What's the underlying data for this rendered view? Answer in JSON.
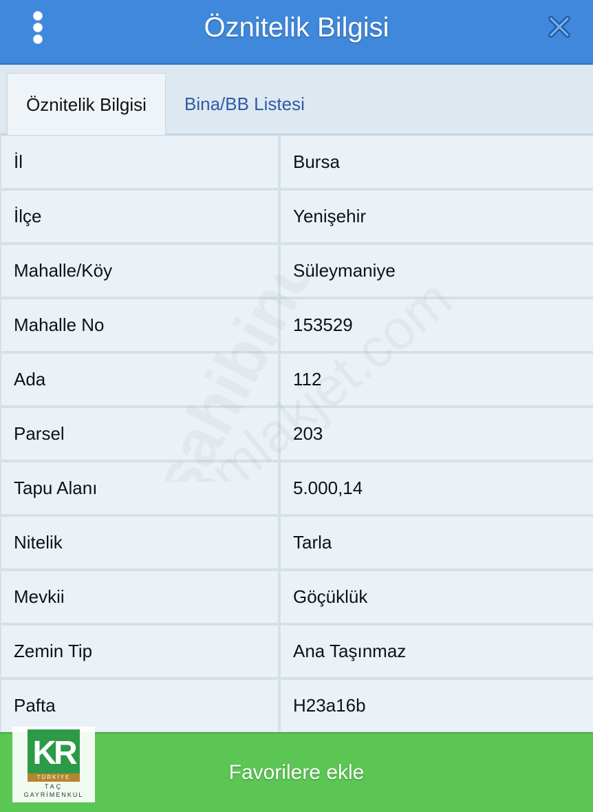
{
  "header": {
    "title": "Öznitelik Bilgisi"
  },
  "tabs": [
    {
      "label": "Öznitelik Bilgisi",
      "active": true
    },
    {
      "label": "Bina/BB Listesi",
      "active": false
    }
  ],
  "rows": [
    {
      "label": "İl",
      "value": "Bursa"
    },
    {
      "label": "İlçe",
      "value": "Yenişehir"
    },
    {
      "label": "Mahalle/Köy",
      "value": "Süleymaniye"
    },
    {
      "label": "Mahalle No",
      "value": "153529"
    },
    {
      "label": "Ada",
      "value": "112"
    },
    {
      "label": "Parsel",
      "value": "203"
    },
    {
      "label": "Tapu Alanı",
      "value": "5.000,14"
    },
    {
      "label": "Nitelik",
      "value": "Tarla"
    },
    {
      "label": "Mevkii",
      "value": "Göçüklük"
    },
    {
      "label": "Zemin Tip",
      "value": "Ana Taşınmaz"
    },
    {
      "label": "Pafta",
      "value": "H23a16b"
    }
  ],
  "footer": {
    "favorite_label": "Favorilere ekle"
  },
  "logo": {
    "mark": "KR",
    "country": "TÜRKİYE",
    "name_line1": "TAÇ",
    "name_line2": "GAYRİMENKUL"
  },
  "watermark": {
    "text1": "sahibinden",
    "text2": "emlakjet.com"
  },
  "colors": {
    "header": "#3f88dc",
    "footer": "#5bc653",
    "tab_link": "#2f5aa8",
    "logo_green": "#2d9a47",
    "logo_gold": "#b7852d"
  },
  "icons": {
    "menu": "vertical-dots-icon",
    "close": "close-icon"
  }
}
